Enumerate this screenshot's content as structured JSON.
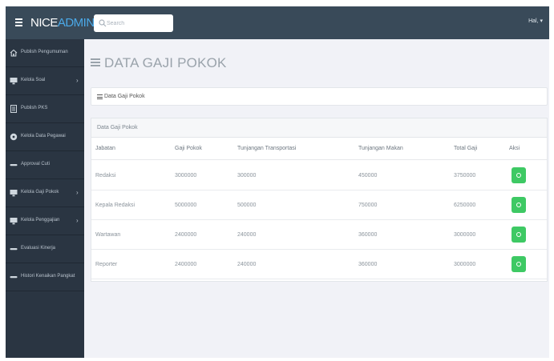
{
  "topbar": {
    "brand_primary": "NICE",
    "brand_accent": "ADMIN",
    "search_placeholder": "Search",
    "user_menu": "Hal, ▾"
  },
  "sidebar": {
    "items": [
      {
        "label": "Publish Pengumuman",
        "icon": "home-icon",
        "caret": ""
      },
      {
        "label": "Kelola Soal",
        "icon": "monitor-icon",
        "caret": "›"
      },
      {
        "label": "Publish PKS",
        "icon": "document-icon",
        "caret": ""
      },
      {
        "label": "Kelola Data Pegawai",
        "icon": "circle-icon",
        "caret": ""
      },
      {
        "label": "Approval Cuti",
        "icon": "dash-icon",
        "caret": ""
      },
      {
        "label": "Kelola Gaji Pokok",
        "icon": "monitor-icon",
        "caret": "›"
      },
      {
        "label": "Kelola Penggajian",
        "icon": "monitor-icon",
        "caret": "›"
      },
      {
        "label": "Evaluasi Kinerja",
        "icon": "dash-icon",
        "caret": ""
      },
      {
        "label": "Histori Kenaikan Pangkat",
        "icon": "dash-icon",
        "caret": ""
      }
    ]
  },
  "main": {
    "page_title": "DATA GAJI POKOK",
    "breadcrumb": "Data Gaji Pokok",
    "panel_heading": "Data Gaji Pokok",
    "table": {
      "headers": [
        "Jabatan",
        "Gaji Pokok",
        "Tunjangan Transportasi",
        "Tunjangan Makan",
        "Total Gaji",
        "Aksi"
      ],
      "rows": [
        [
          "Redaksi",
          "3000000",
          "300000",
          "450000",
          "3750000"
        ],
        [
          "Kepala Redaksi",
          "5000000",
          "500000",
          "750000",
          "6250000"
        ],
        [
          "Wartawan",
          "2400000",
          "240000",
          "360000",
          "3000000"
        ],
        [
          "Reporter",
          "2400000",
          "240000",
          "360000",
          "3000000"
        ]
      ],
      "action_icon": "settings-icon"
    }
  },
  "colors": {
    "topbar": "#394a59",
    "sidebar": "#2a3542",
    "brand_accent": "#4ba9e8",
    "action_button": "#3ec964",
    "content_bg": "#f1f2f7"
  }
}
